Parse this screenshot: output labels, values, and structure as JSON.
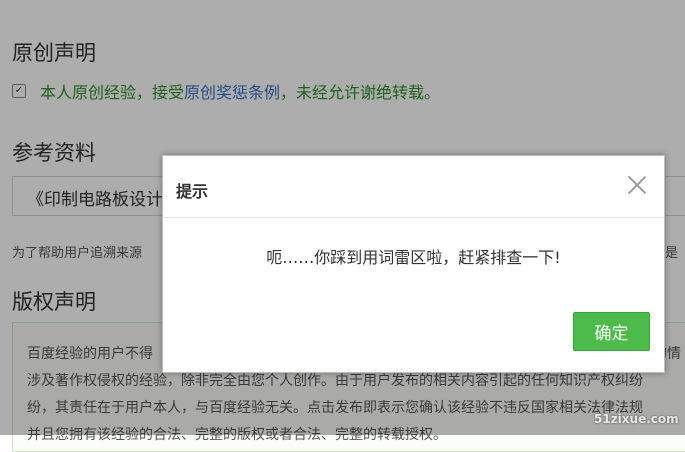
{
  "sections": {
    "original_title": "原创声明",
    "reference_title": "参考资料",
    "copyright_title": "版权声明"
  },
  "agreement": {
    "checked": true,
    "text_before": "本人原创经验，接受",
    "link_text": "原创奖惩条例",
    "text_after": "，未经允许谢绝转载。"
  },
  "reference": {
    "value": "《印制电路板设计"
  },
  "help": {
    "left_text": "为了帮助用户追溯来源",
    "right_text": "是"
  },
  "copyright": {
    "lines": [
      "百度经验的用户不得",
      "涉及著作权侵权的经验，除非完全由您个人创作。由于用户发布的相关内容引起的任何知识产权纠纷",
      "纷，其责任在于用户本人，与百度经验无关。点击发布即表示您确认该经验不违反国家相关法律法规",
      "并且您拥有该经验的合法、完整的版权或者合法、完整的转载授权。"
    ],
    "right_fragment": "的情"
  },
  "dialog": {
    "title": "提示",
    "message": "呃……你踩到用词雷区啦，赶紧排查一下!",
    "ok_label": "确定"
  },
  "watermark": "51zixue.com",
  "colors": {
    "accent_green": "#4cbb4a",
    "agree_text": "#2f8f2f",
    "link_blue": "#3a6fc7",
    "overlay": "rgba(0,0,0,0.32)"
  }
}
